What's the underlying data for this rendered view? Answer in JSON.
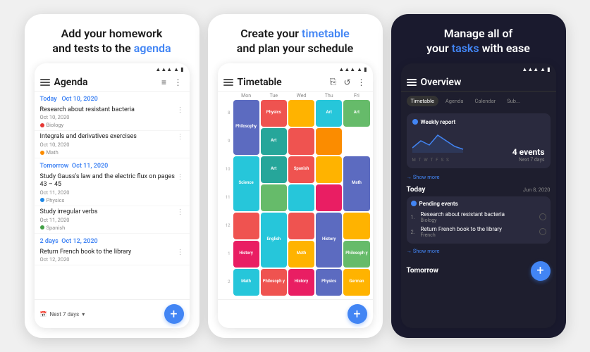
{
  "card1": {
    "header_line1": "Add your homework",
    "header_line2": "and tests to the",
    "header_highlight": "agenda",
    "app_bar": {
      "title": "Agenda",
      "menu": "☰"
    },
    "status_bar": "▲ ▲ ▲",
    "date_sections": [
      {
        "label": "Today   Oct 10, 2020",
        "items": [
          {
            "title": "Research about resistant bacteria",
            "date": "Oct 10, 2020",
            "subject": "Biology",
            "dot_color": "#e53935"
          },
          {
            "title": "Integrals and derivatives exercises",
            "date": "Oct 10, 2020",
            "subject": "Math",
            "dot_color": "#fb8c00"
          }
        ]
      },
      {
        "label": "Tomorrow  Oct 11, 2020",
        "items": [
          {
            "title": "Study Gauss's law and the electric flux on pages 43 – 45",
            "date": "Oct 11, 2020",
            "subject": "Physics",
            "dot_color": "#1e88e5"
          },
          {
            "title": "Study irregular verbs",
            "date": "Oct 11, 2020",
            "subject": "Spanish",
            "dot_color": "#43a047"
          }
        ]
      },
      {
        "label": "2 days  Oct 12, 2020",
        "items": [
          {
            "title": "Return French book to the library",
            "date": "Oct 12, 2020",
            "subject": "",
            "dot_color": ""
          }
        ]
      }
    ],
    "bottom_text": "Next 7 days",
    "fab_label": "+"
  },
  "card2": {
    "header_line1": "Create your",
    "header_highlight": "timetable",
    "header_line2": "and plan your schedule",
    "app_bar": {
      "title": "Timetable"
    },
    "days": [
      "Mon",
      "Tue",
      "Wed",
      "Thu",
      "Fri"
    ],
    "times": [
      "8",
      "9",
      "10",
      "11",
      "12",
      "1",
      "2"
    ],
    "cells": [
      {
        "row": 1,
        "col": 1,
        "label": "Philosophy",
        "color": "#5c6bc0",
        "rowspan": 2
      },
      {
        "row": 1,
        "col": 2,
        "label": "Physics",
        "color": "#ef5350",
        "rowspan": 1
      },
      {
        "row": 1,
        "col": 3,
        "label": "",
        "color": "#ffb300",
        "rowspan": 1
      },
      {
        "row": 1,
        "col": 4,
        "label": "Art",
        "color": "#26c6da",
        "rowspan": 1
      },
      {
        "row": 2,
        "col": 2,
        "label": "Art",
        "color": "#26a69a",
        "rowspan": 1
      },
      {
        "row": 3,
        "col": 1,
        "label": "Science",
        "color": "#26c6da",
        "rowspan": 2
      },
      {
        "row": 3,
        "col": 2,
        "label": "Art",
        "color": "#26a69a",
        "rowspan": 1
      },
      {
        "row": 3,
        "col": 3,
        "label": "Spanish",
        "color": "#ef5350",
        "rowspan": 1
      },
      {
        "row": 3,
        "col": 4,
        "label": "",
        "color": "#ffb300",
        "rowspan": 1
      },
      {
        "row": 3,
        "col": 5,
        "label": "Math",
        "color": "#5c6bc0",
        "rowspan": 2
      },
      {
        "row": 4,
        "col": 2,
        "label": "",
        "color": "#66bb6a",
        "rowspan": 1
      },
      {
        "row": 5,
        "col": 2,
        "label": "English",
        "color": "#26c6da",
        "rowspan": 2
      },
      {
        "row": 5,
        "col": 3,
        "label": "",
        "color": "#ef5350",
        "rowspan": 1
      },
      {
        "row": 5,
        "col": 4,
        "label": "History",
        "color": "#5c6bc0",
        "rowspan": 2
      },
      {
        "row": 6,
        "col": 1,
        "label": "History",
        "color": "#e91e63",
        "rowspan": 1
      },
      {
        "row": 6,
        "col": 3,
        "label": "Math",
        "color": "#ffb300",
        "rowspan": 1
      },
      {
        "row": 6,
        "col": 5,
        "label": "Philosophy",
        "color": "#66bb6a",
        "rowspan": 1
      },
      {
        "row": 7,
        "col": 1,
        "label": "Math",
        "color": "#26c6da",
        "rowspan": 1
      },
      {
        "row": 7,
        "col": 2,
        "label": "Philosoph y",
        "color": "#ef5350",
        "rowspan": 1
      },
      {
        "row": 7,
        "col": 3,
        "label": "History",
        "color": "#e91e63",
        "rowspan": 1
      },
      {
        "row": 7,
        "col": 4,
        "label": "Physics",
        "color": "#5c6bc0",
        "rowspan": 1
      },
      {
        "row": 7,
        "col": 5,
        "label": "German",
        "color": "#ffb300",
        "rowspan": 1
      }
    ],
    "fab_label": "+"
  },
  "card3": {
    "header_line1": "Manage all of",
    "header_line2": "your",
    "header_highlight": "tasks",
    "header_line3": "with ease",
    "app_bar": {
      "title": "Overview"
    },
    "tabs": [
      "Timetable",
      "Agenda",
      "Calendar",
      "Sub..."
    ],
    "active_tab": "Timetable",
    "weekly_report": {
      "title": "Weekly report",
      "events_count": "4 events",
      "events_label": "Next 7 days",
      "days": [
        "M",
        "T",
        "W",
        "T",
        "F",
        "S",
        "S"
      ],
      "chart_values": [
        2,
        5,
        3,
        7,
        4,
        2,
        1
      ]
    },
    "show_more": "→ Show more",
    "today_label": "Today",
    "today_date": "Jun 8, 2020",
    "pending_events": {
      "title": "Pending events",
      "items": [
        {
          "num": "1.",
          "title": "Research about resistant bacteria",
          "subject": "Biology"
        },
        {
          "num": "2.",
          "title": "Return French book to the library",
          "subject": "French"
        }
      ]
    },
    "show_more2": "→ Show more",
    "tomorrow_label": "Tomorrow",
    "fab_label": "+"
  }
}
